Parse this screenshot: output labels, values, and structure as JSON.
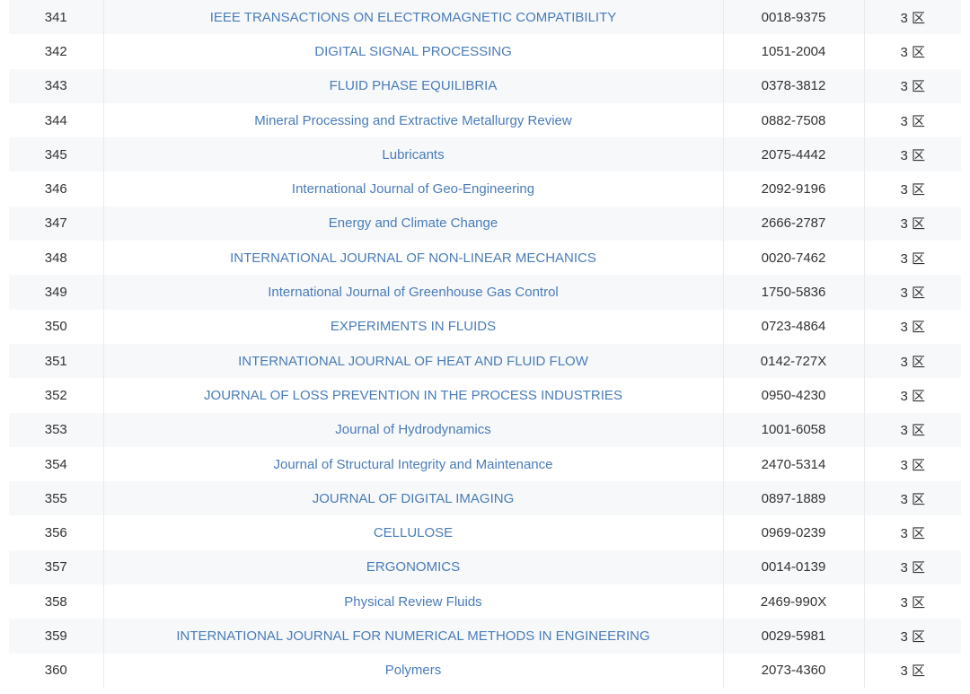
{
  "table": {
    "rows": [
      {
        "rank": "341",
        "title": "IEEE TRANSACTIONS ON ELECTROMAGNETIC COMPATIBILITY",
        "issn": "0018-9375",
        "zone": "3 区"
      },
      {
        "rank": "342",
        "title": "DIGITAL SIGNAL PROCESSING",
        "issn": "1051-2004",
        "zone": "3 区"
      },
      {
        "rank": "343",
        "title": "FLUID PHASE EQUILIBRIA",
        "issn": "0378-3812",
        "zone": "3 区"
      },
      {
        "rank": "344",
        "title": "Mineral Processing and Extractive Metallurgy Review",
        "issn": "0882-7508",
        "zone": "3 区"
      },
      {
        "rank": "345",
        "title": "Lubricants",
        "issn": "2075-4442",
        "zone": "3 区"
      },
      {
        "rank": "346",
        "title": "International Journal of Geo-Engineering",
        "issn": "2092-9196",
        "zone": "3 区"
      },
      {
        "rank": "347",
        "title": "Energy and Climate Change",
        "issn": "2666-2787",
        "zone": "3 区"
      },
      {
        "rank": "348",
        "title": "INTERNATIONAL JOURNAL OF NON-LINEAR MECHANICS",
        "issn": "0020-7462",
        "zone": "3 区"
      },
      {
        "rank": "349",
        "title": "International Journal of Greenhouse Gas Control",
        "issn": "1750-5836",
        "zone": "3 区"
      },
      {
        "rank": "350",
        "title": "EXPERIMENTS IN FLUIDS",
        "issn": "0723-4864",
        "zone": "3 区"
      },
      {
        "rank": "351",
        "title": "INTERNATIONAL JOURNAL OF HEAT AND FLUID FLOW",
        "issn": "0142-727X",
        "zone": "3 区"
      },
      {
        "rank": "352",
        "title": "JOURNAL OF LOSS PREVENTION IN THE PROCESS INDUSTRIES",
        "issn": "0950-4230",
        "zone": "3 区"
      },
      {
        "rank": "353",
        "title": "Journal of Hydrodynamics",
        "issn": "1001-6058",
        "zone": "3 区"
      },
      {
        "rank": "354",
        "title": "Journal of Structural Integrity and Maintenance",
        "issn": "2470-5314",
        "zone": "3 区"
      },
      {
        "rank": "355",
        "title": "JOURNAL OF DIGITAL IMAGING",
        "issn": "0897-1889",
        "zone": "3 区"
      },
      {
        "rank": "356",
        "title": "CELLULOSE",
        "issn": "0969-0239",
        "zone": "3 区"
      },
      {
        "rank": "357",
        "title": "ERGONOMICS",
        "issn": "0014-0139",
        "zone": "3 区"
      },
      {
        "rank": "358",
        "title": "Physical Review Fluids",
        "issn": "2469-990X",
        "zone": "3 区"
      },
      {
        "rank": "359",
        "title": "INTERNATIONAL JOURNAL FOR NUMERICAL METHODS IN ENGINEERING",
        "issn": "0029-5981",
        "zone": "3 区"
      },
      {
        "rank": "360",
        "title": "Polymers",
        "issn": "2073-4360",
        "zone": "3 区"
      }
    ]
  },
  "colors": {
    "link": "#4a7cb8",
    "row_alt": "#f7f8fa",
    "text": "#333333"
  }
}
